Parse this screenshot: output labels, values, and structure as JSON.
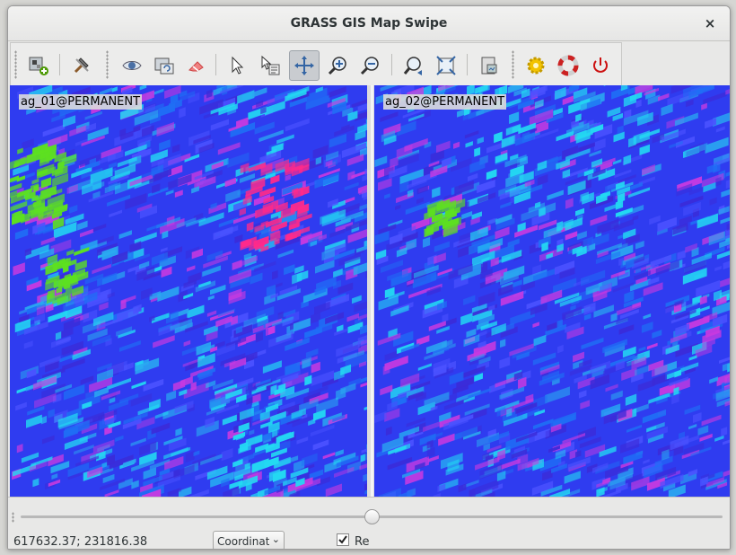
{
  "window": {
    "title": "GRASS GIS Map Swipe",
    "close_glyph": "×"
  },
  "toolbar": {
    "tools": [
      {
        "name": "add-map-icon"
      },
      {
        "name": "tools-hammer-icon"
      },
      {
        "name": "display-map-icon"
      },
      {
        "name": "render-map-icon"
      },
      {
        "name": "erase-icon"
      },
      {
        "name": "pointer-icon"
      },
      {
        "name": "query-icon"
      },
      {
        "name": "pan-icon",
        "active": true
      },
      {
        "name": "zoom-in-icon"
      },
      {
        "name": "zoom-out-icon"
      },
      {
        "name": "zoom-back-icon"
      },
      {
        "name": "zoom-extent-icon"
      },
      {
        "name": "save-image-icon"
      },
      {
        "name": "settings-gear-icon"
      },
      {
        "name": "help-lifebuoy-icon"
      },
      {
        "name": "quit-power-icon"
      }
    ]
  },
  "maps": {
    "left_label": "ag_01@PERMANENT",
    "right_label": "ag_02@PERMANENT"
  },
  "swipe": {
    "position_percent": 50
  },
  "status": {
    "coordinates": "617632.37; 231816.38",
    "display_mode": "Coordinates",
    "render_checkbox_label": "Re",
    "render_checked": true
  },
  "colors": {
    "map_blue": "#2f3cf0",
    "map_cyan": "#23d9f2",
    "map_magenta": "#c93ae0",
    "map_green": "#5de020"
  }
}
